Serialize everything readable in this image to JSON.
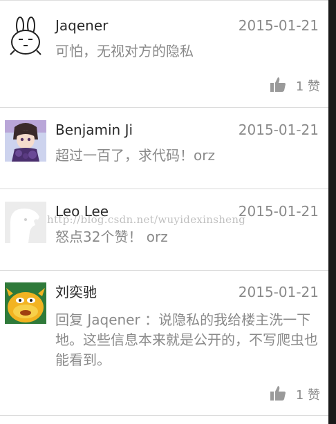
{
  "comments": [
    {
      "username": "Jaqener",
      "date": "2015-01-21",
      "text": "可怕，无视对方的隐私",
      "avatar": "rabbit-cartoon-avatar",
      "like_count": "1",
      "like_label": "赞"
    },
    {
      "username": "Benjamin Ji",
      "date": "2015-01-21",
      "text": "超过一百了，求代码！orz",
      "avatar": "anime-boy-avatar"
    },
    {
      "username": "Leo Lee",
      "date": "2015-01-21",
      "text": "怒点32个赞！ orz",
      "avatar": "default-ghost-avatar"
    },
    {
      "username": "刘奕驰",
      "date": "2015-01-21",
      "text": "回复 Jaqener ：说隐私的我给楼主洗一下地。这些信息本来就是公开的，不写爬虫也能看到。",
      "avatar": "cartoon-monster-avatar",
      "like_count": "1",
      "like_label": "赞"
    }
  ],
  "watermark": "http://blog.csdn.net/wuyidexinsheng",
  "colors": {
    "name": "#2a2a2a",
    "secondary": "#8a8a8a",
    "divider": "#d9d9d9"
  }
}
